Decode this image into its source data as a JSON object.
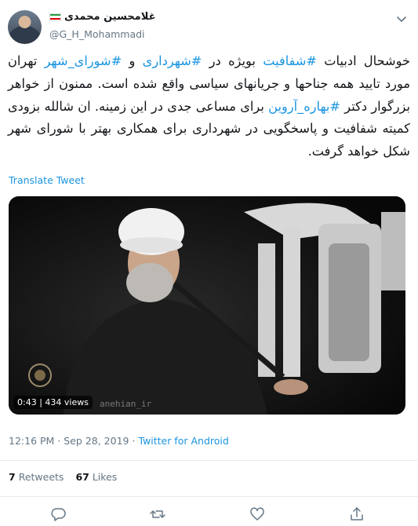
{
  "user": {
    "name": "غلامحسین محمدی",
    "handle": "@G_H_Mohammadi"
  },
  "tweet": {
    "segments": [
      {
        "t": "خوشحال ادبیات ",
        "h": false
      },
      {
        "t": "#شفافیت",
        "h": true
      },
      {
        "t": " بویژه در ",
        "h": false
      },
      {
        "t": "#شهرداری",
        "h": true
      },
      {
        "t": " و ",
        "h": false
      },
      {
        "t": "#شورای_شهر",
        "h": true
      },
      {
        "t": " تهران مورد تایید همه جناحها و جریانهای سیاسی واقع شده است. ممنون از خواهر بزرگوار دکتر ",
        "h": false
      },
      {
        "t": "#بهاره_آروین",
        "h": true
      },
      {
        "t": " برای مساعی جدی در این زمینه. ان شالله بزودی کمیته شفافیت و پاسخگویی در شهرداری برای همکاری بهتر با شورای شهر شکل خواهد گرفت.",
        "h": false
      }
    ],
    "translate_label": "Translate Tweet"
  },
  "video": {
    "duration": "0:43",
    "views": "434 views",
    "watermark": "anehian_ir"
  },
  "meta": {
    "time": "12:16 PM",
    "date": "Sep 28, 2019",
    "separator": "·",
    "source": "Twitter for Android"
  },
  "stats": {
    "retweets_count": "7",
    "retweets_label": "Retweets",
    "likes_count": "67",
    "likes_label": "Likes"
  },
  "icons": [
    "chevron-down-icon",
    "reply-icon",
    "retweet-icon",
    "like-icon",
    "share-icon"
  ],
  "colors": {
    "link": "#1b95e0",
    "muted": "#657786",
    "text": "#14171a",
    "divider": "#e6ecf0"
  }
}
